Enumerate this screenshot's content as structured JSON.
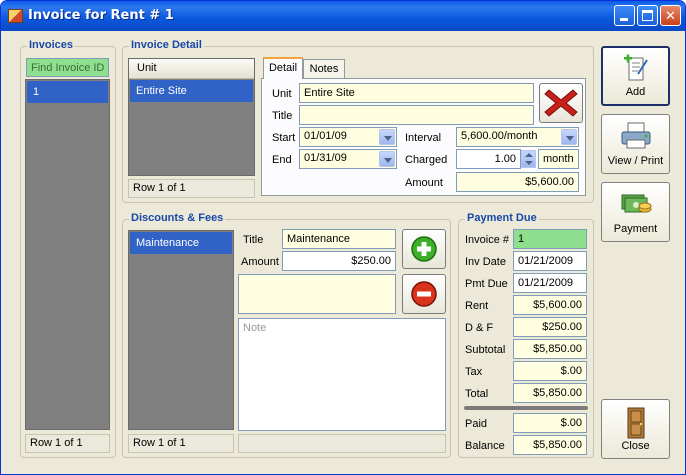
{
  "window": {
    "title": "Invoice for Rent # 1"
  },
  "invoices": {
    "title": "Invoices",
    "find_placeholder": "Find Invoice ID",
    "items": [
      "1"
    ],
    "row_status": "Row 1 of 1"
  },
  "invoice_detail": {
    "title": "Invoice Detail",
    "unit_header": "Unit",
    "units": [
      "Entire Site"
    ],
    "row_status": "Row 1 of 1",
    "tabs": [
      "Detail",
      "Notes"
    ],
    "labels": {
      "unit": "Unit",
      "title": "Title",
      "start": "Start",
      "end": "End",
      "interval": "Interval",
      "charged": "Charged",
      "amount": "Amount"
    },
    "unit_value": "Entire Site",
    "title_value": "",
    "start_value": "01/01/09",
    "end_value": "01/31/09",
    "interval_value": "5,600.00/month",
    "charged_value": "1.00",
    "charged_unit": "month",
    "amount_value": "$5,600.00"
  },
  "discounts": {
    "title": "Discounts & Fees",
    "items": [
      "Maintenance"
    ],
    "row_status": "Row 1 of 1",
    "labels": {
      "title": "Title",
      "amount": "Amount"
    },
    "title_value": "Maintenance",
    "amount_value": "$250.00",
    "description_value": "",
    "note_placeholder": "Note"
  },
  "payment_due": {
    "title": "Payment Due",
    "rows": [
      {
        "label": "Invoice #",
        "value": "1"
      },
      {
        "label": "Inv Date",
        "value": "01/21/2009"
      },
      {
        "label": "Pmt Due",
        "value": "01/21/2009"
      },
      {
        "label": "Rent",
        "value": "$5,600.00"
      },
      {
        "label": "D & F",
        "value": "$250.00"
      },
      {
        "label": "Subtotal",
        "value": "$5,850.00"
      },
      {
        "label": "Tax",
        "value": "$.00"
      },
      {
        "label": "Total",
        "value": "$5,850.00"
      }
    ],
    "paid_label": "Paid",
    "paid_value": "$.00",
    "balance_label": "Balance",
    "balance_value": "$5,850.00"
  },
  "actions": {
    "add": "Add",
    "view_print": "View / Print",
    "payment": "Payment",
    "close": "Close"
  },
  "colors": {
    "title_blue": "#1848a8",
    "selection": "#3162c6",
    "input_bg": "#fffee0",
    "invoice_id_bg": "#8ee08e",
    "delete_red": "#c8201b",
    "add_green": "#3fae2a"
  }
}
